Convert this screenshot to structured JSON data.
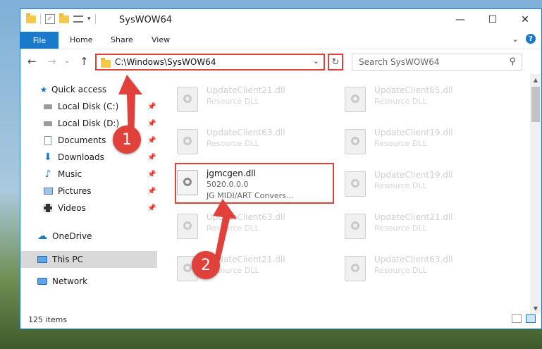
{
  "window": {
    "title": "SysWOW64",
    "minimize": "—",
    "maximize": "☐",
    "close": "✕"
  },
  "ribbon": {
    "tabs": [
      {
        "label": "File"
      },
      {
        "label": "Home"
      },
      {
        "label": "Share"
      },
      {
        "label": "View"
      }
    ],
    "collapse": "⌄",
    "help": "?"
  },
  "nav": {
    "back": "←",
    "forward": "→",
    "recent": "⌄",
    "up": "↑",
    "address": "C:\\Windows\\SysWOW64",
    "address_dropdown": "⌄",
    "refresh": "↻",
    "search_placeholder": "Search SysWOW64",
    "search_icon": "⚲"
  },
  "sidebar": {
    "items": [
      {
        "label": "Quick access",
        "icon": "star-icon"
      },
      {
        "label": "Local Disk (C:)",
        "icon": "drive-icon",
        "pinned": true
      },
      {
        "label": "Local Disk (D:)",
        "icon": "drive-icon",
        "pinned": true
      },
      {
        "label": "Documents",
        "icon": "documents-icon",
        "pinned": true
      },
      {
        "label": "Downloads",
        "icon": "download-icon",
        "pinned": true
      },
      {
        "label": "Music",
        "icon": "music-icon",
        "pinned": true
      },
      {
        "label": "Pictures",
        "icon": "pictures-icon",
        "pinned": true
      },
      {
        "label": "Videos",
        "icon": "videos-icon",
        "pinned": true
      },
      {
        "label": "OneDrive",
        "icon": "cloud-icon"
      },
      {
        "label": "This PC",
        "icon": "computer-icon",
        "selected": true
      },
      {
        "label": "Network",
        "icon": "network-icon"
      }
    ],
    "pin_glyph": "📌"
  },
  "files": [
    {
      "name": "UpdateClient21.dll",
      "desc": "Resource DLL"
    },
    {
      "name": "UpdateClient65.dll",
      "desc": "Resource DLL"
    },
    {
      "name": "UpdateClient63.dll",
      "desc": "Resource DLL"
    },
    {
      "name": "UpdateClient19.dll",
      "desc": "Resource DLL"
    },
    {
      "name": "jgmcgen.dll",
      "desc": "5020.0.0.0",
      "desc2": "JG MIDI/ART Convers...",
      "active": true
    },
    {
      "name": "UpdateClient19.dll",
      "desc": "Resource DLL"
    },
    {
      "name": "UpdateClient63.dll",
      "desc": "Resource DLL"
    },
    {
      "name": "UpdateClient21.dll",
      "desc": "Resource DLL"
    },
    {
      "name": "UpdateClient21.dll",
      "desc": "Resource DLL"
    },
    {
      "name": "UpdateClient63.dll",
      "desc": "Resource DLL"
    }
  ],
  "status": {
    "count": "125 items"
  },
  "annotations": {
    "step1": "1",
    "step2": "2",
    "color": "#e0413a"
  }
}
